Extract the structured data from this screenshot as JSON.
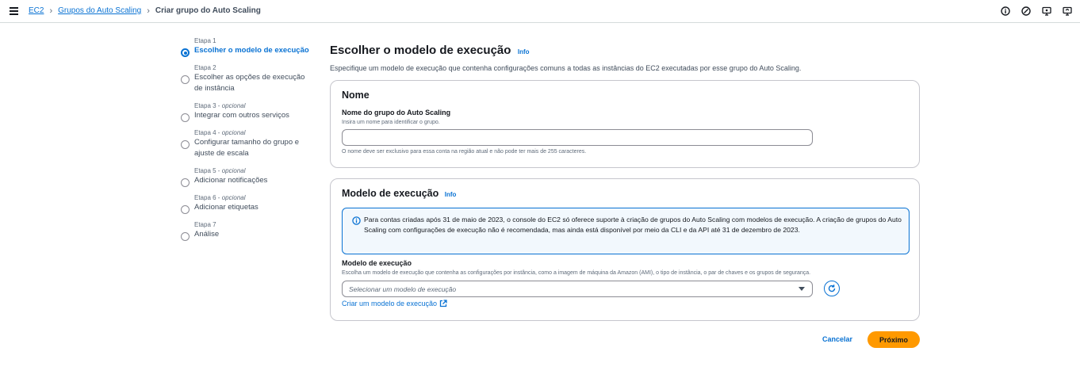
{
  "breadcrumb": {
    "items": [
      {
        "label": "EC2"
      },
      {
        "label": "Grupos do Auto Scaling"
      },
      {
        "label": "Criar grupo do Auto Scaling"
      }
    ]
  },
  "top_icons": [
    "info-circle-icon",
    "feedback-icon",
    "notifications-icon",
    "settings-icon"
  ],
  "steps": [
    {
      "number": "Etapa 1",
      "optional": "",
      "title": "Escolher o modelo de execução",
      "active": true
    },
    {
      "number": "Etapa 2",
      "optional": "",
      "title": "Escolher as opções de execução de instância"
    },
    {
      "number": "Etapa 3",
      "optional": "opcional",
      "title": "Integrar com outros serviços"
    },
    {
      "number": "Etapa 4",
      "optional": "opcional",
      "title": "Configurar tamanho do grupo e ajuste de escala"
    },
    {
      "number": "Etapa 5",
      "optional": "opcional",
      "title": "Adicionar notificações"
    },
    {
      "number": "Etapa 6",
      "optional": "opcional",
      "title": "Adicionar etiquetas"
    },
    {
      "number": "Etapa 7",
      "optional": "",
      "title": "Análise"
    }
  ],
  "page": {
    "title": "Escolher o modelo de execução",
    "info": "Info",
    "description": "Especifique um modelo de execução que contenha configurações comuns a todas as instâncias do EC2 executadas por esse grupo do Auto Scaling."
  },
  "name_card": {
    "title": "Nome",
    "field_label": "Nome do grupo do Auto Scaling",
    "field_desc": "Insira um nome para identificar o grupo.",
    "value": "",
    "constraint": "O nome deve ser exclusivo para essa conta na região atual e não pode ter mais de 255 caracteres."
  },
  "template_card": {
    "title": "Modelo de execução",
    "info": "Info",
    "alert": "Para contas criadas após 31 de maio de 2023, o console do EC2 só oferece suporte à criação de grupos do Auto Scaling com modelos de execução. A criação de grupos do Auto Scaling com configurações de execução não é recomendada, mas ainda está disponível por meio da CLI e da API até 31 de dezembro de 2023.",
    "field_label": "Modelo de execução",
    "field_desc": "Escolha um modelo de execução que contenha as configurações por instância, como a imagem de máquina da Amazon (AMI), o tipo de instância, o par de chaves e os grupos de segurança.",
    "select_placeholder": "Selecionar um modelo de execução",
    "create_link": "Criar um modelo de execução"
  },
  "actions": {
    "cancel": "Cancelar",
    "next": "Próximo"
  },
  "colors": {
    "link": "#0972d3",
    "primary_button": "#ff9900",
    "alert_bg": "#f2f8fd"
  }
}
